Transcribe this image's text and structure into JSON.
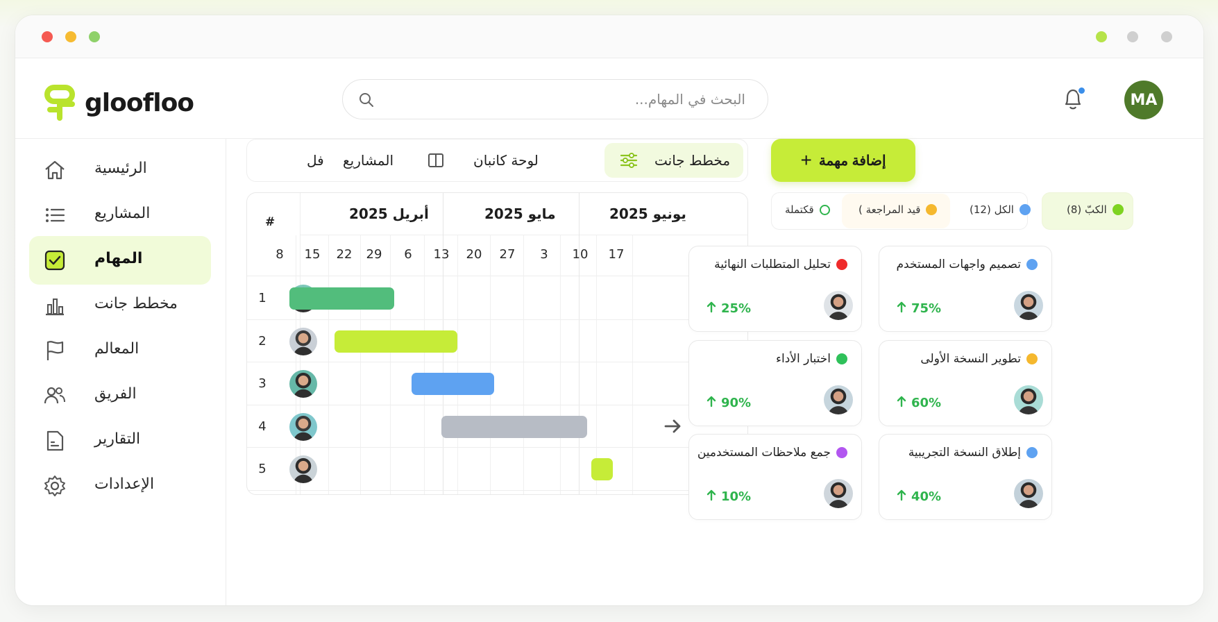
{
  "app": {
    "name": "gloofloo",
    "brand_color": "#c6ec38"
  },
  "header": {
    "search_placeholder": "البحث في المهام...",
    "user_initials": "MA",
    "notification_badge": true
  },
  "sidebar": {
    "items": [
      {
        "label": "الرئيسية",
        "icon": "home-icon",
        "active": false
      },
      {
        "label": "المشاريع",
        "icon": "list-icon",
        "active": false
      },
      {
        "label": "المهام",
        "icon": "checkbox-icon",
        "active": true
      },
      {
        "label": "مخطط جانت",
        "icon": "bar-chart-icon",
        "active": false
      },
      {
        "label": "المعالم",
        "icon": "flag-icon",
        "active": false
      },
      {
        "label": "الفريق",
        "icon": "users-icon",
        "active": false
      },
      {
        "label": "التقارير",
        "icon": "report-icon",
        "active": false
      },
      {
        "label": "الإعدادات",
        "icon": "gear-icon",
        "active": false
      }
    ]
  },
  "toolbar": {
    "add_task_label": "إضافة مهمة",
    "tabs": [
      {
        "label": "مخطط جانت",
        "icon": "sliders-icon",
        "active": true
      },
      {
        "label": "لوحة كانبان",
        "icon": "kanban-icon",
        "active": false
      },
      {
        "label": "المشاريع",
        "icon": "",
        "active": false
      },
      {
        "label": "فل",
        "icon": "",
        "active": false
      }
    ]
  },
  "gantt": {
    "header_label": "#",
    "months": [
      "أبريل 2025",
      "مايو 2025",
      "يونيو 2025"
    ],
    "days": [
      "8",
      "15",
      "22",
      "29",
      "6",
      "13",
      "20",
      "27",
      "3",
      "10",
      "17"
    ],
    "rows": [
      {
        "num": "1",
        "start_day_index": 0.3,
        "end_day_index": 3.6,
        "color": "#52bd7c"
      },
      {
        "num": "2",
        "start_day_index": 1.7,
        "end_day_index": 5.5,
        "color": "#c6ec38"
      },
      {
        "num": "3",
        "start_day_index": 4.1,
        "end_day_index": 6.6,
        "color": "#5ea2f1"
      },
      {
        "num": "4",
        "start_day_index": 5.0,
        "end_day_index": 9.2,
        "color": "#b7bcc5"
      },
      {
        "num": "5",
        "start_day_index": 9.3,
        "end_day_index": 9.9,
        "color": "#c6ec38"
      }
    ],
    "arrow_icon": "arrow-right-icon"
  },
  "filters": [
    {
      "label": "الكبّ (8)",
      "color": "#7ed321"
    },
    {
      "label": "الكل (12)",
      "color": "#5ea2f1"
    },
    {
      "label": "قيد المراجعة )",
      "color": "#f5b82e"
    },
    {
      "label": "قكتملة",
      "color": "#2fb44d"
    }
  ],
  "tasks": [
    {
      "title": "تصميم واجهات المستخدم",
      "color": "#5ea2f1",
      "progress": "75%"
    },
    {
      "title": "تحليل المتطلبات النهائية",
      "color": "#ef2b2b",
      "progress": "25%"
    },
    {
      "title": "تطوير النسخة الأولى",
      "color": "#f5b82e",
      "progress": "60%"
    },
    {
      "title": "اختبار الأداء",
      "color": "#2fc15a",
      "progress": "90%"
    },
    {
      "title": "إطلاق النسخة التجريبية",
      "color": "#5ea2f1",
      "progress": "40%"
    },
    {
      "title": "جمع ملاحظات المستخدمين",
      "color": "#b256f0",
      "progress": "10%"
    }
  ]
}
